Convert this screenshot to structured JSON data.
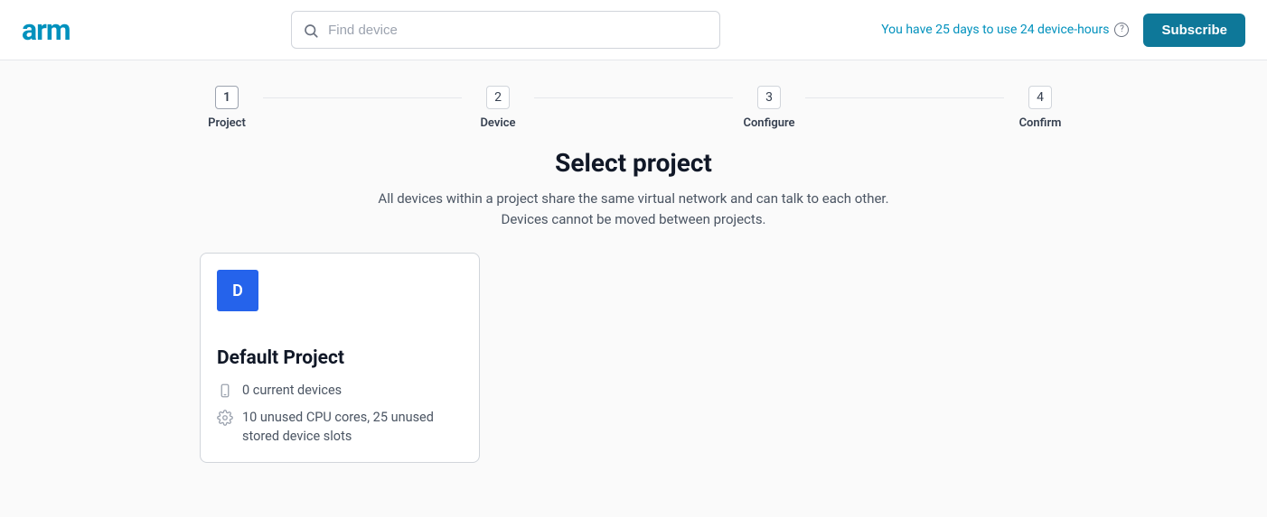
{
  "header": {
    "logo": "arm",
    "search_placeholder": "Find device",
    "trial_text": "You have 25 days to use 24 device-hours",
    "subscribe_label": "Subscribe"
  },
  "stepper": {
    "steps": [
      {
        "num": "1",
        "label": "Project"
      },
      {
        "num": "2",
        "label": "Device"
      },
      {
        "num": "3",
        "label": "Configure"
      },
      {
        "num": "4",
        "label": "Confirm"
      }
    ]
  },
  "page": {
    "title": "Select project",
    "description_line1": "All devices within a project share the same virtual network and can talk to each other.",
    "description_line2": "Devices cannot be moved between projects."
  },
  "projects": [
    {
      "initial": "D",
      "name": "Default Project",
      "devices_text": "0 current devices",
      "resources_text": "10 unused CPU cores, 25 unused stored device slots"
    }
  ]
}
